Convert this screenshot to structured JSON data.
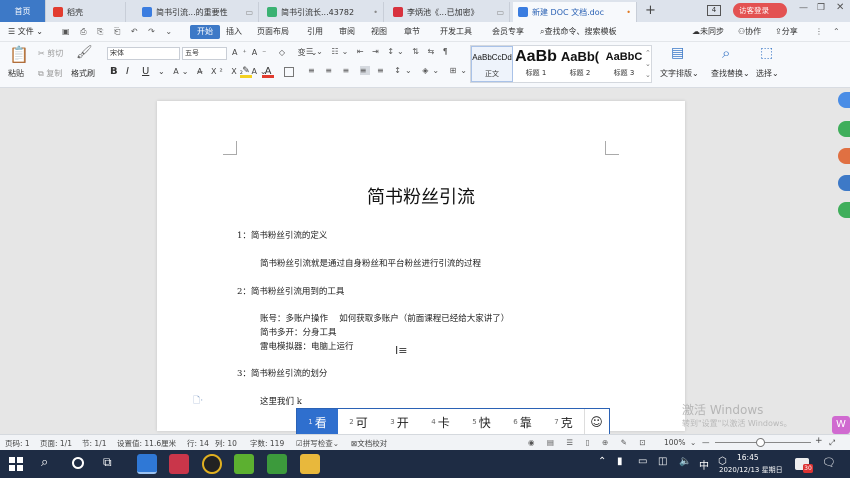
{
  "tabs": [
    {
      "label": "首页"
    },
    {
      "label": "稻壳"
    },
    {
      "label": "简书引流...的重要性"
    },
    {
      "label": "简书引流长...43782"
    },
    {
      "label": "李炳池《...已加密》"
    },
    {
      "label": "新建 DOC 文档.doc"
    }
  ],
  "tab_new": "+",
  "tab_count": "4",
  "login_label": "访客登录",
  "menu": {
    "file": "文件",
    "tabs": [
      "开始",
      "插入",
      "页面布局",
      "引用",
      "审阅",
      "视图",
      "章节",
      "开发工具",
      "会员专享"
    ],
    "search_placeholder": "查找命令、搜索模板",
    "sync": "未同步",
    "collab": "协作",
    "share": "分享"
  },
  "ribbon": {
    "cut": "剪切",
    "copy": "复制",
    "paste": "粘贴",
    "format_painter": "格式刷",
    "font_name": "宋体",
    "font_size": "五号",
    "bold": "B",
    "italic": "I",
    "underline": "U",
    "styles": [
      {
        "sample": "AaBbCcDd",
        "label": "正文"
      },
      {
        "sample": "AaBb",
        "label": "标题 1"
      },
      {
        "sample": "AaBb(",
        "label": "标题 2"
      },
      {
        "sample": "AaBbC",
        "label": "标题 3"
      }
    ],
    "text_layout": "文字排版",
    "find_replace": "查找替换",
    "select": "选择"
  },
  "doc": {
    "title": "简书粉丝引流",
    "lines": [
      "1：简书粉丝引流的定义",
      "简书粉丝引流就是通过自身粉丝和平台粉丝进行引流的过程",
      "2：简书粉丝引流用到的工具",
      "账号：多账户操作　 如何获取多账户（前面课程已经给大家讲了）",
      "简书多开：分身工具",
      "雷电模拟器：电脑上运行",
      "3：简书粉丝引流的划分",
      "这里我们 k"
    ]
  },
  "ime": {
    "candidates": [
      {
        "n": "1",
        "t": "看"
      },
      {
        "n": "2",
        "t": "可"
      },
      {
        "n": "3",
        "t": "开"
      },
      {
        "n": "4",
        "t": "卡"
      },
      {
        "n": "5",
        "t": "快"
      },
      {
        "n": "6",
        "t": "靠"
      },
      {
        "n": "7",
        "t": "克"
      }
    ],
    "emoji": "☺"
  },
  "watermark": {
    "line1": "激活 Windows",
    "line2": "转到\"设置\"以激活 Windows。"
  },
  "status": {
    "page": "页码: 1",
    "pages": "页面: 1/1",
    "section": "节: 1/1",
    "setting": "设置值: 11.6厘米",
    "row": "行: 14",
    "col": "列: 10",
    "words": "字数: 119",
    "spell": "拼写检查",
    "proof": "文档校对",
    "zoom": "100%"
  },
  "taskbar": {
    "ime_lang": "中",
    "time": "16:45",
    "date": "2020/12/13 星期日",
    "notif": "30"
  }
}
